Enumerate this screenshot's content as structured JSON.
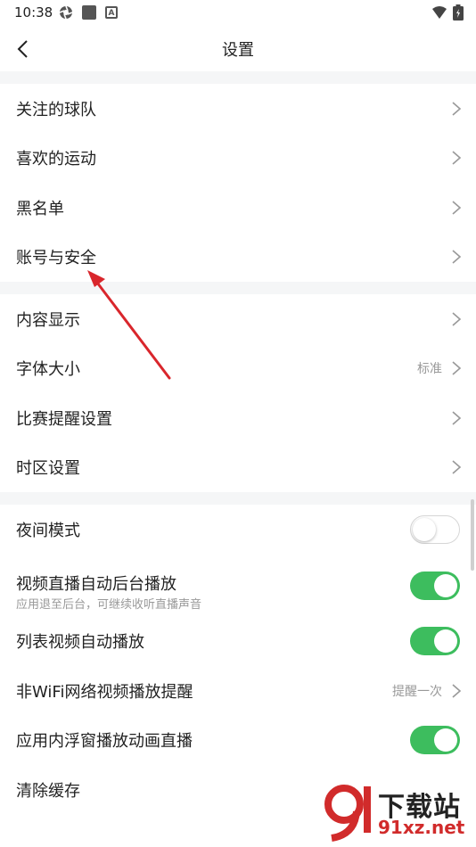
{
  "status_bar": {
    "time": "10:38",
    "left_icons": [
      "aperture-icon",
      "square-app-icon",
      "a-box-icon"
    ],
    "right_icons": [
      "wifi-icon",
      "battery-icon"
    ]
  },
  "header": {
    "title": "设置",
    "back_icon": "chevron-left-icon"
  },
  "section1": {
    "items": [
      {
        "label": "关注的球队"
      },
      {
        "label": "喜欢的运动"
      },
      {
        "label": "黑名单"
      },
      {
        "label": "账号与安全"
      }
    ]
  },
  "section2": {
    "items": [
      {
        "label": "内容显示",
        "value": ""
      },
      {
        "label": "字体大小",
        "value": "标准"
      },
      {
        "label": "比赛提醒设置",
        "value": ""
      },
      {
        "label": "时区设置",
        "value": ""
      }
    ]
  },
  "section3": {
    "items": [
      {
        "label": "夜间模式",
        "toggle": false
      },
      {
        "label": "视频直播自动后台播放",
        "sub": "应用退至后台，可继续收听直播声音",
        "toggle": true
      },
      {
        "label": "列表视频自动播放",
        "toggle": true
      },
      {
        "label": "非WiFi网络视频播放提醒",
        "value": "提醒一次"
      },
      {
        "label": "应用内浮窗播放动画直播",
        "toggle": true
      },
      {
        "label": "清除缓存"
      }
    ]
  },
  "colors": {
    "toggle_on": "#3dbd5e",
    "annotation_arrow": "#d9262c",
    "background": "#f5f6f7"
  },
  "watermark": {
    "line1": "下载站",
    "line2": "91xz.net",
    "logo_icon": "91-logo-icon"
  }
}
